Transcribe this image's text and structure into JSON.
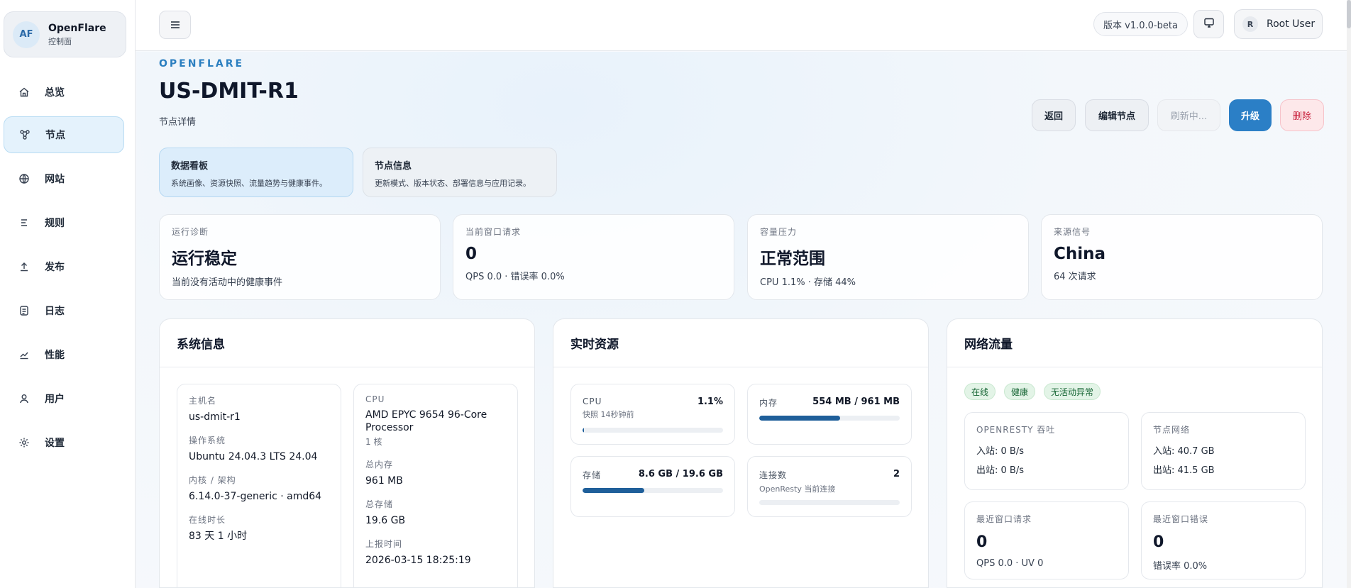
{
  "brand": {
    "initials": "AF",
    "name": "OpenFlare",
    "subtitle": "控制面"
  },
  "nav": [
    {
      "label": "总览",
      "icon": "home-icon"
    },
    {
      "label": "节点",
      "icon": "nodes-icon",
      "active": true
    },
    {
      "label": "网站",
      "icon": "globe-icon"
    },
    {
      "label": "规则",
      "icon": "rules-icon"
    },
    {
      "label": "发布",
      "icon": "upload-icon"
    },
    {
      "label": "日志",
      "icon": "log-icon"
    },
    {
      "label": "性能",
      "icon": "chart-icon"
    },
    {
      "label": "用户",
      "icon": "user-icon"
    },
    {
      "label": "设置",
      "icon": "settings-icon"
    }
  ],
  "topbar": {
    "version": "版本 v1.0.0-beta",
    "user_initial": "R",
    "user_name": "Root User"
  },
  "header": {
    "eyebrow": "OPENFLARE",
    "title": "US-DMIT-R1",
    "subtitle": "节点详情",
    "actions": {
      "back": "返回",
      "edit": "编辑节点",
      "refresh": "刷新中...",
      "upgrade": "升级",
      "delete": "删除"
    }
  },
  "tabs": [
    {
      "title": "数据看板",
      "desc": "系统画像、资源快照、流量趋势与健康事件。"
    },
    {
      "title": "节点信息",
      "desc": "更新模式、版本状态、部署信息与应用记录。"
    }
  ],
  "stats": [
    {
      "label": "运行诊断",
      "value": "运行稳定",
      "sub": "当前没有活动中的健康事件"
    },
    {
      "label": "当前窗口请求",
      "value": "0",
      "sub": "QPS 0.0 · 错误率 0.0%"
    },
    {
      "label": "容量压力",
      "value": "正常范围",
      "sub": "CPU 1.1% · 存储 44%"
    },
    {
      "label": "来源信号",
      "value": "China",
      "sub": "64 次请求"
    }
  ],
  "system_info": {
    "title": "系统信息",
    "left": [
      {
        "label": "主机名",
        "value": "us-dmit-r1"
      },
      {
        "label": "操作系统",
        "value": "Ubuntu 24.04.3 LTS 24.04"
      },
      {
        "label": "内核 / 架构",
        "value": "6.14.0-37-generic · amd64"
      },
      {
        "label": "在线时长",
        "value": "83 天 1 小时"
      }
    ],
    "right": [
      {
        "label": "CPU",
        "value": "AMD EPYC 9654 96-Core Processor",
        "sub": "1 核"
      },
      {
        "label": "总内存",
        "value": "961 MB"
      },
      {
        "label": "总存储",
        "value": "19.6 GB"
      },
      {
        "label": "上报时间",
        "value": "2026-03-15 18:25:19"
      }
    ]
  },
  "resources": {
    "title": "实时资源",
    "cpu": {
      "label": "CPU",
      "value": "1.1%",
      "sub": "快照 14秒钟前",
      "fraction": 0.011
    },
    "memory": {
      "label": "内存",
      "value": "554 MB / 961 MB",
      "fraction": 0.576
    },
    "storage": {
      "label": "存储",
      "value": "8.6 GB / 19.6 GB",
      "fraction": 0.439
    },
    "connections": {
      "label": "连接数",
      "value": "2",
      "sub": "OpenResty 当前连接",
      "fraction": 0.0
    }
  },
  "network": {
    "title": "网络流量",
    "pills": [
      "在线",
      "健康",
      "无活动异常"
    ],
    "openresty": {
      "label": "OPENRESTY 吞吐",
      "in": "入站: 0 B/s",
      "out": "出站: 0 B/s"
    },
    "node_net": {
      "label": "节点网络",
      "in": "入站: 40.7 GB",
      "out": "出站: 41.5 GB"
    },
    "recent_req": {
      "label": "最近窗口请求",
      "value": "0",
      "sub": "QPS 0.0 · UV 0"
    },
    "recent_err": {
      "label": "最近窗口错误",
      "value": "0",
      "sub": "错误率 0.0%"
    }
  }
}
